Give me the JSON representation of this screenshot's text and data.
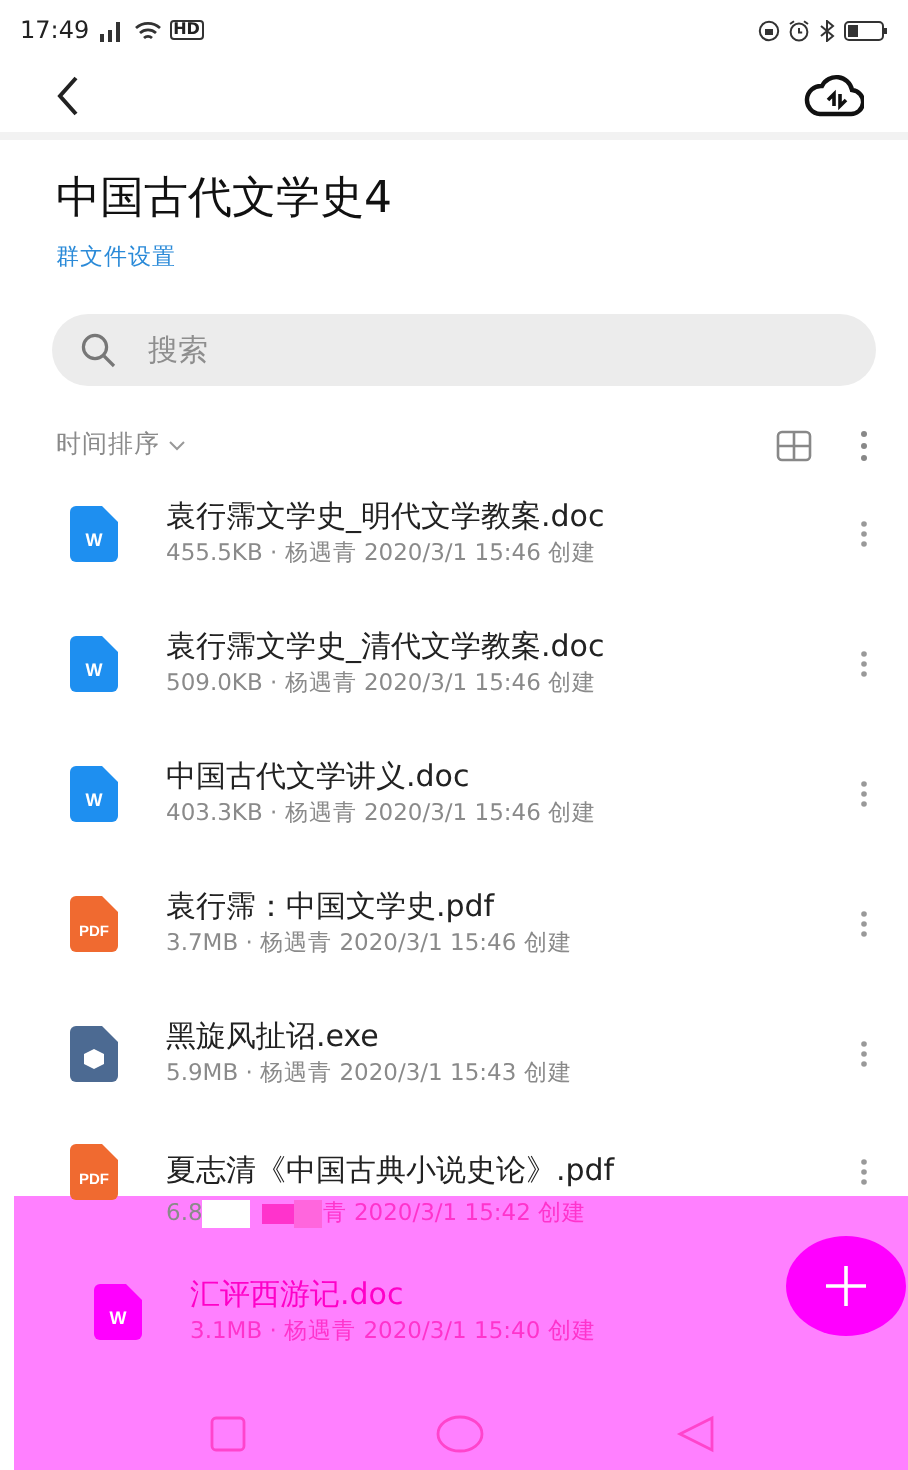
{
  "status_bar": {
    "time": "17:49",
    "network": "HD"
  },
  "header": {
    "title": "中国古代文学史4",
    "settings_link": "群文件设置"
  },
  "search": {
    "placeholder": "搜索"
  },
  "sort": {
    "label": "时间排序"
  },
  "files": [
    {
      "kind": "doc",
      "icon_label": "W",
      "name": "袁行霈文学史_明代文学教案.doc",
      "meta": "455.5KB · 杨遇青 2020/3/1 15:46 创建"
    },
    {
      "kind": "doc",
      "icon_label": "W",
      "name": "袁行霈文学史_清代文学教案.doc",
      "meta": "509.0KB · 杨遇青 2020/3/1 15:46 创建"
    },
    {
      "kind": "doc",
      "icon_label": "W",
      "name": "中国古代文学讲义.doc",
      "meta": "403.3KB · 杨遇青 2020/3/1 15:46 创建"
    },
    {
      "kind": "pdf",
      "icon_label": "PDF",
      "name": "袁行霈：中国文学史.pdf",
      "meta": "3.7MB · 杨遇青 2020/3/1 15:46 创建"
    },
    {
      "kind": "exe",
      "name": "黑旋风扯诏.exe",
      "meta": "5.9MB · 杨遇青 2020/3/1 15:43 创建"
    },
    {
      "kind": "pdf",
      "icon_label": "PDF",
      "name": "夏志清《中国古典小说史论》.pdf",
      "meta_parts": [
        "6.8",
        "青 2020/3/1 15:42 创建"
      ]
    },
    {
      "kind": "doc",
      "icon_label": "W",
      "name": "汇评西游记.doc",
      "meta": "3.1MB · 杨遇青 2020/3/1 15:40 创建"
    }
  ]
}
